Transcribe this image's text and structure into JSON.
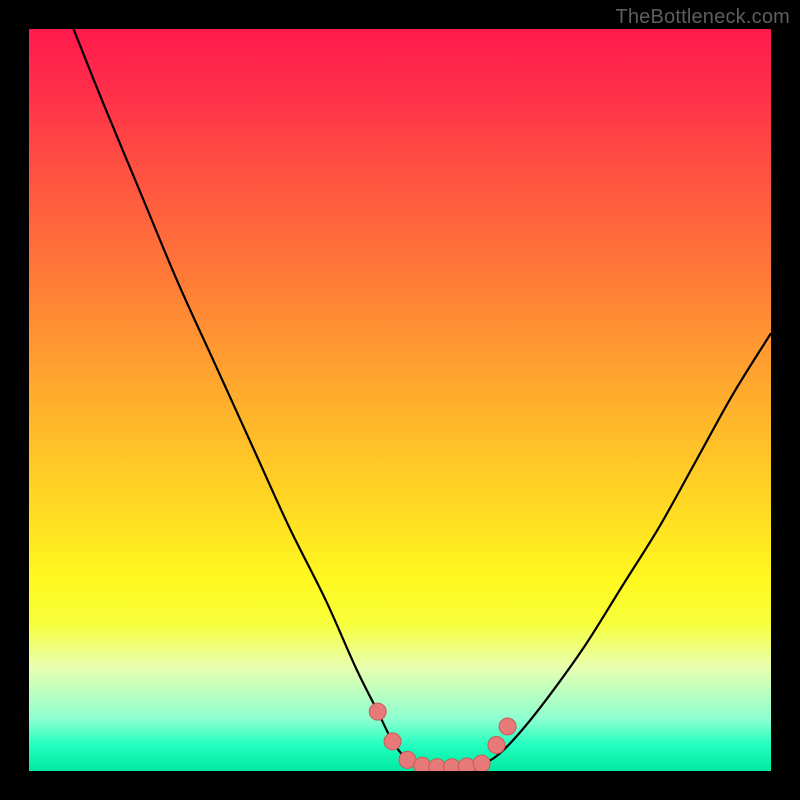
{
  "watermark": "TheBottleneck.com",
  "colors": {
    "marker_fill": "#e77a78",
    "marker_stroke": "#c65c5a",
    "curve_stroke": "#000000"
  },
  "chart_data": {
    "type": "line",
    "title": "",
    "xlabel": "",
    "ylabel": "",
    "xlim": [
      0,
      100
    ],
    "ylim": [
      0,
      100
    ],
    "series": [
      {
        "name": "bottleneck-curve",
        "x": [
          6,
          10,
          15,
          20,
          25,
          30,
          35,
          40,
          44,
          47,
          49,
          51,
          53,
          55,
          57,
          59,
          61,
          63,
          66,
          70,
          75,
          80,
          85,
          90,
          95,
          100
        ],
        "y": [
          100,
          90,
          78,
          66,
          55,
          44,
          33,
          23,
          14,
          8,
          4,
          1.5,
          0.7,
          0.5,
          0.5,
          0.6,
          1.0,
          2.0,
          5,
          10,
          17,
          25,
          33,
          42,
          51,
          59
        ]
      }
    ],
    "markers": {
      "name": "highlighted-points",
      "points": [
        {
          "x": 47.0,
          "y": 8.0
        },
        {
          "x": 49.0,
          "y": 4.0
        },
        {
          "x": 51.0,
          "y": 1.5
        },
        {
          "x": 53.0,
          "y": 0.7
        },
        {
          "x": 55.0,
          "y": 0.5
        },
        {
          "x": 57.0,
          "y": 0.5
        },
        {
          "x": 59.0,
          "y": 0.6
        },
        {
          "x": 61.0,
          "y": 1.0
        },
        {
          "x": 63.0,
          "y": 3.5
        },
        {
          "x": 64.5,
          "y": 6.0
        }
      ]
    }
  }
}
